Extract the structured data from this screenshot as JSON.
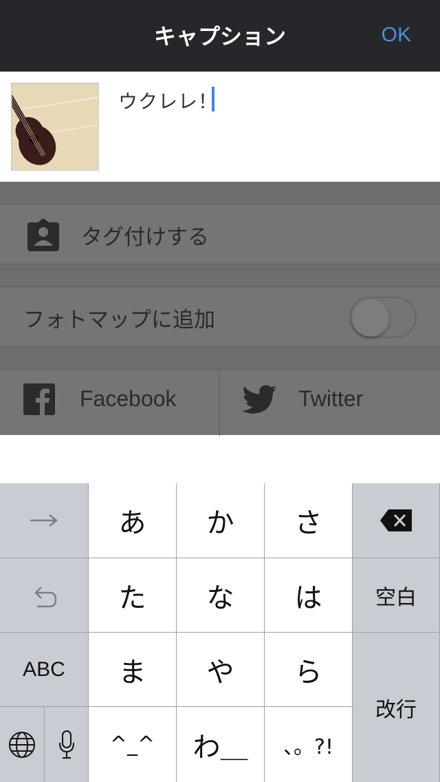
{
  "header": {
    "title": "キャプション",
    "ok_label": "OK"
  },
  "caption": {
    "text": "ウクレレ！"
  },
  "options": {
    "tag_label": "タグ付けする",
    "photomap_label": "フォトマップに追加",
    "photomap_enabled": false,
    "facebook_label": "Facebook",
    "twitter_label": "Twitter"
  },
  "keyboard": {
    "row1": [
      "あ",
      "か",
      "さ"
    ],
    "row2": [
      "た",
      "な",
      "は"
    ],
    "row3": [
      "ま",
      "や",
      "ら"
    ],
    "row4": [
      "^_^",
      "わ＿",
      "、。?!"
    ],
    "space_label": "空白",
    "return_label": "改行",
    "abc_label": "ABC",
    "icons": [
      "arrow-right-icon",
      "undo-icon",
      "globe-icon",
      "microphone-icon",
      "backspace-icon"
    ]
  },
  "colors": {
    "header_bg": "#26272b",
    "accent": "#4a90e2",
    "cursor": "#3b82f6"
  }
}
